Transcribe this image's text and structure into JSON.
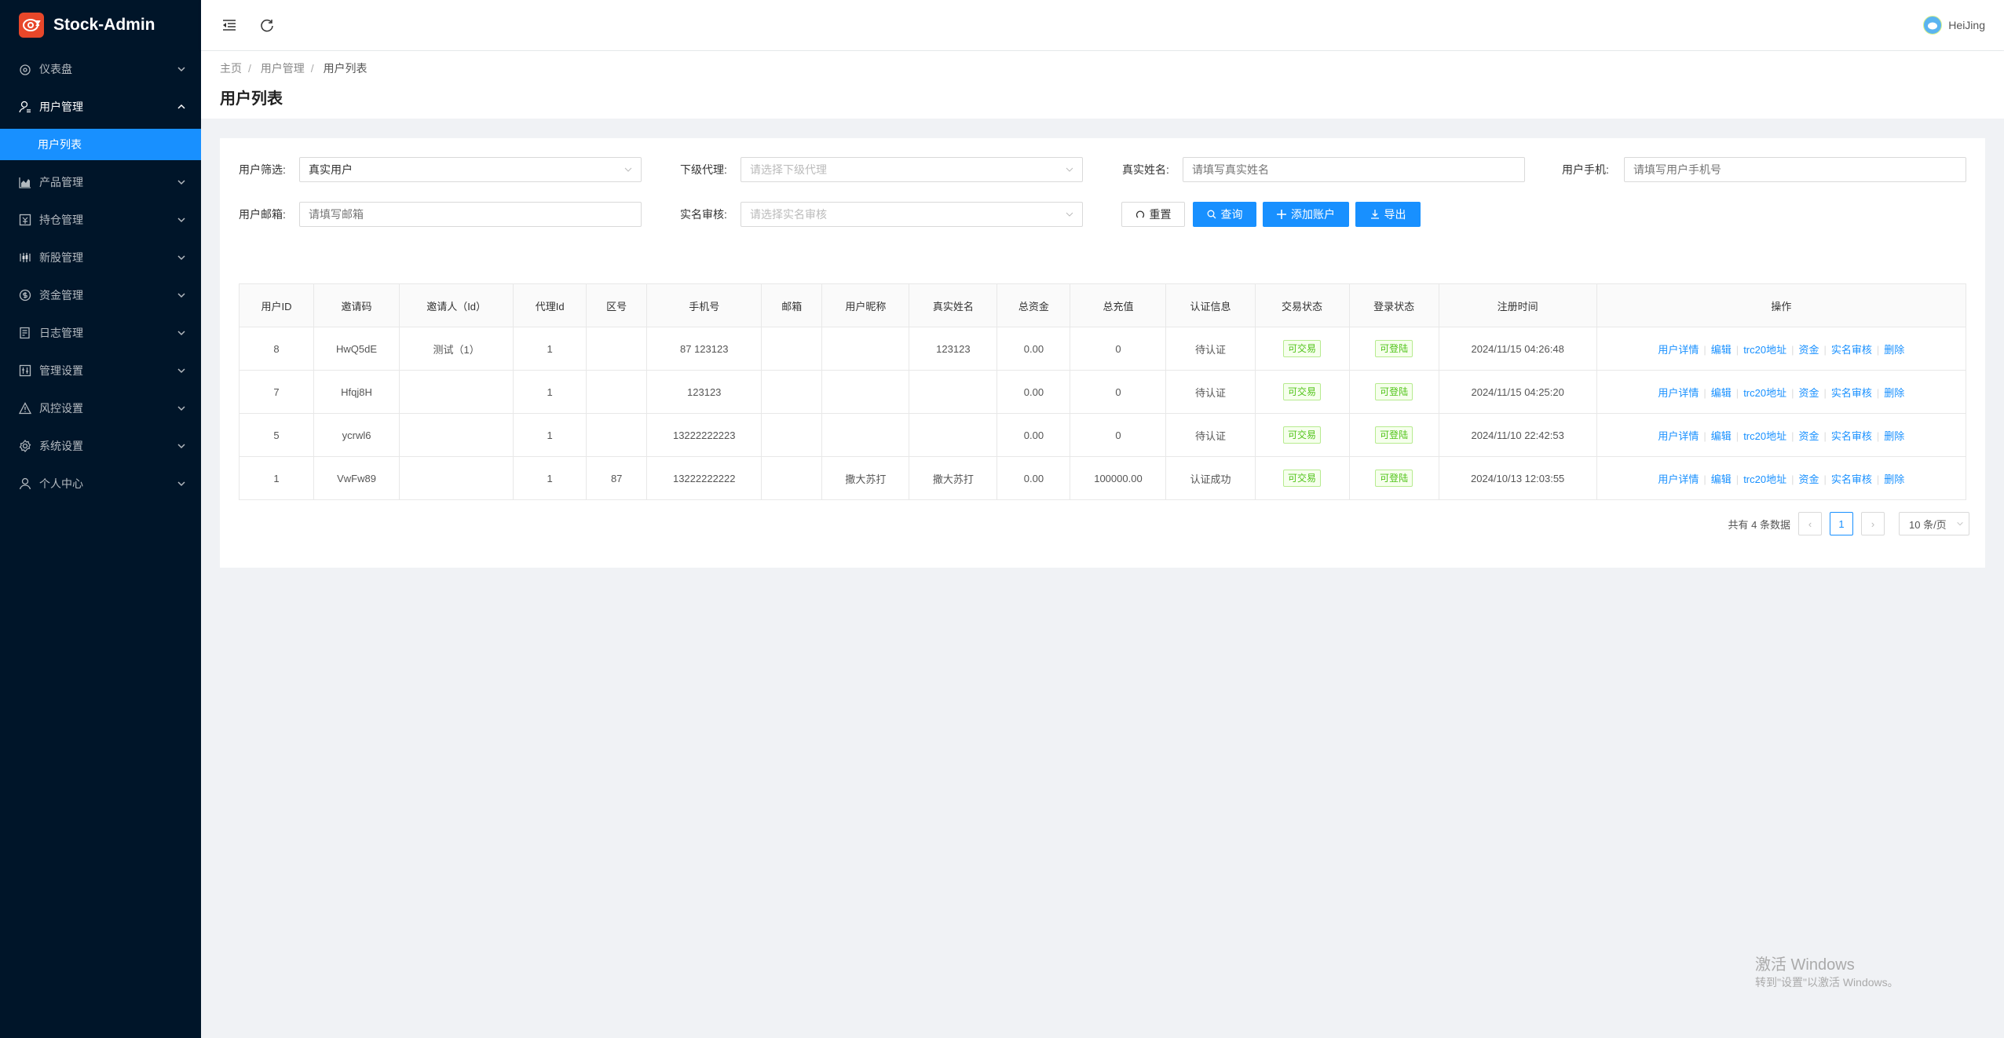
{
  "app": {
    "title": "Stock-Admin"
  },
  "sidebar": {
    "items": [
      {
        "label": "仪表盘",
        "icon": "dashboard-icon"
      },
      {
        "label": "用户管理",
        "icon": "user-manage-icon",
        "open": true,
        "children": [
          {
            "label": "用户列表",
            "active": true
          }
        ]
      },
      {
        "label": "产品管理",
        "icon": "chart-icon"
      },
      {
        "label": "持仓管理",
        "icon": "position-icon"
      },
      {
        "label": "新股管理",
        "icon": "ipo-icon"
      },
      {
        "label": "资金管理",
        "icon": "dollar-icon"
      },
      {
        "label": "日志管理",
        "icon": "log-icon"
      },
      {
        "label": "管理设置",
        "icon": "settings-panel-icon"
      },
      {
        "label": "风控设置",
        "icon": "warning-icon"
      },
      {
        "label": "系统设置",
        "icon": "gear-icon"
      },
      {
        "label": "个人中心",
        "icon": "user-icon"
      }
    ]
  },
  "header": {
    "username": "HeiJing"
  },
  "breadcrumb": [
    "主页",
    "用户管理",
    "用户列表"
  ],
  "page_title": "用户列表",
  "filters": {
    "user_filter": {
      "label": "用户筛选:",
      "value": "真实用户"
    },
    "agent": {
      "label": "下级代理:",
      "placeholder": "请选择下级代理"
    },
    "real_name": {
      "label": "真实姓名:",
      "placeholder": "请填写真实姓名"
    },
    "phone": {
      "label": "用户手机:",
      "placeholder": "请填写用户手机号"
    },
    "email": {
      "label": "用户邮箱:",
      "placeholder": "请填写邮箱"
    },
    "verify": {
      "label": "实名审核:",
      "placeholder": "请选择实名审核"
    }
  },
  "buttons": {
    "reset": "重置",
    "search": "查询",
    "add": "添加账户",
    "export": "导出"
  },
  "table": {
    "columns": [
      "用户ID",
      "邀请码",
      "邀请人（Id）",
      "代理Id",
      "区号",
      "手机号",
      "邮箱",
      "用户昵称",
      "真实姓名",
      "总资金",
      "总充值",
      "认证信息",
      "交易状态",
      "登录状态",
      "注册时间",
      "操作"
    ],
    "rows": [
      [
        "8",
        "HwQ5dE",
        "测试（1）",
        "1",
        "",
        "87 123123",
        "",
        "",
        "123123",
        "0.00",
        "0",
        "待认证",
        "可交易",
        "可登陆",
        "2024/11/15 04:26:48"
      ],
      [
        "7",
        "Hfqj8H",
        "",
        "1",
        "",
        "123123",
        "",
        "",
        "",
        "0.00",
        "0",
        "待认证",
        "可交易",
        "可登陆",
        "2024/11/15 04:25:20"
      ],
      [
        "5",
        "ycrwl6",
        "",
        "1",
        "",
        "13222222223",
        "",
        "",
        "",
        "0.00",
        "0",
        "待认证",
        "可交易",
        "可登陆",
        "2024/11/10 22:42:53"
      ],
      [
        "1",
        "VwFw89",
        "",
        "1",
        "87",
        "13222222222",
        "",
        "撒大苏打",
        "撒大苏打",
        "0.00",
        "100000.00",
        "认证成功",
        "可交易",
        "可登陆",
        "2024/10/13 12:03:55"
      ]
    ],
    "actions": [
      "用户详情",
      "编辑",
      "trc20地址",
      "资金",
      "实名审核",
      "删除"
    ]
  },
  "pagination": {
    "total_text": "共有 4 条数据",
    "current_page": "1",
    "page_size": "10 条/页"
  },
  "watermark": {
    "line1": "激活 Windows",
    "line2": "转到\"设置\"以激活 Windows。"
  },
  "colors": {
    "sidebar": "#001529",
    "primary": "#1890ff",
    "success": "#52c41a"
  }
}
